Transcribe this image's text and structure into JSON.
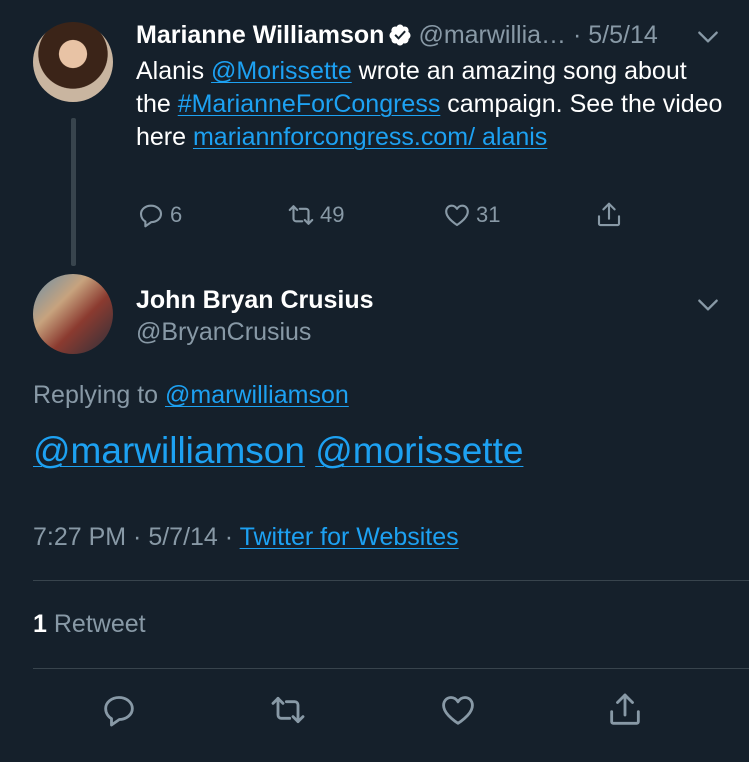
{
  "tweet1": {
    "name": "Marianne Williamson",
    "handle": "@marwillia…",
    "date": "5/5/14",
    "body_part1": "Alanis ",
    "mention": "@Morissette",
    "body_part2": " wrote an amazing song about the ",
    "hashtag": "#MarianneForCongress",
    "body_part3": " campaign. See the video here ",
    "url": "mariannforcongress.com/ alanis",
    "replies": "6",
    "retweets": "49",
    "likes": "31"
  },
  "tweet2": {
    "name": "John Bryan Crusius",
    "handle": "@BryanCrusius",
    "replying_prefix": "Replying to ",
    "replying_to": "@marwilliamson",
    "mention1": "@marwilliamson",
    "mention2": "@morissette",
    "time": "7:27 PM",
    "date": "5/7/14",
    "source": "Twitter for Websites",
    "retweet_count": "1",
    "retweet_label": "Retweet"
  },
  "colors": {
    "background": "#15202b",
    "accent": "#1da1f2",
    "secondary_text": "#8899a6",
    "divider": "#38444d"
  }
}
